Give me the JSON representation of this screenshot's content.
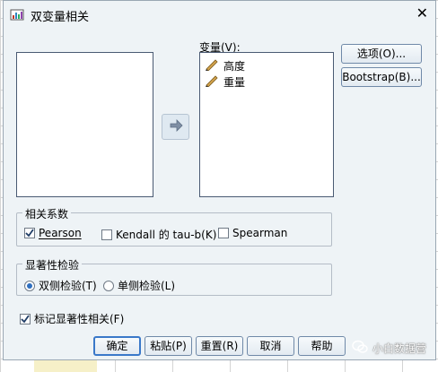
{
  "dialog": {
    "title": "双变量相关",
    "close_symbol": "✕"
  },
  "variables": {
    "label": "变量(V):",
    "items": [
      {
        "label": "高度"
      },
      {
        "label": "重量"
      }
    ]
  },
  "side_buttons": {
    "options": "选项(O)...",
    "bootstrap": "Bootstrap(B)..."
  },
  "correlation": {
    "legend": "相关系数",
    "pearson": {
      "label": "Pearson",
      "checked": true
    },
    "kendall": {
      "label": "Kendall 的 tau-b(K)",
      "checked": false
    },
    "spearman": {
      "label": "Spearman",
      "checked": false
    }
  },
  "significance": {
    "legend": "显著性检验",
    "two_tailed": {
      "label": "双侧检验(T)",
      "selected": true
    },
    "one_tailed": {
      "label": "单侧检验(L)",
      "selected": false
    }
  },
  "flag": {
    "label": "标记显著性相关(F)",
    "checked": true
  },
  "buttons": {
    "ok": "确定",
    "paste": "粘贴(P)",
    "reset": "重置(R)",
    "cancel": "取消",
    "help": "帮助"
  },
  "watermark": {
    "text": "小白数据营"
  },
  "colors": {
    "accent": "#3a78c9",
    "dialog_bg": "#eef3f6",
    "pencil": "#d2a24c"
  },
  "icons": {
    "app": "spss-icon",
    "move": "arrow-right-icon",
    "variable": "ruler-pencil-icon"
  }
}
